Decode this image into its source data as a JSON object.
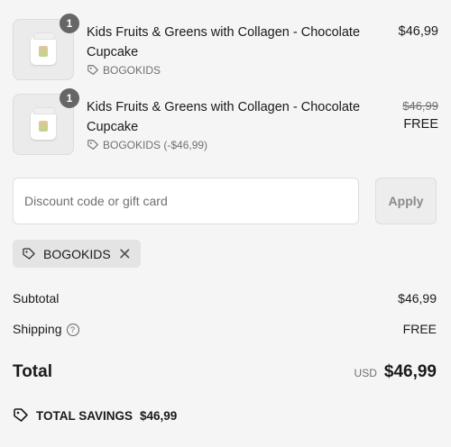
{
  "items": [
    {
      "quantity": "1",
      "title": "Kids Fruits & Greens with Collagen - Chocolate Cupcake",
      "discount_code": "BOGOKIDS",
      "price": "$46,99",
      "original_price": "",
      "final_price": ""
    },
    {
      "quantity": "1",
      "title": "Kids Fruits & Greens with Collagen - Chocolate Cupcake",
      "discount_code": "BOGOKIDS (-$46,99)",
      "price": "",
      "original_price": "$46,99",
      "final_price": "FREE"
    }
  ],
  "discount": {
    "placeholder": "Discount code or gift card",
    "apply_label": "Apply",
    "applied_code": "BOGOKIDS"
  },
  "summary": {
    "subtotal_label": "Subtotal",
    "subtotal_value": "$46,99",
    "shipping_label": "Shipping",
    "shipping_value": "FREE",
    "total_label": "Total",
    "currency": "USD",
    "total_value": "$46,99",
    "savings_label": "TOTAL SAVINGS",
    "savings_value": "$46,99"
  },
  "icons": {
    "tag": "tag-icon",
    "close": "close-icon",
    "help": "question-circle-icon",
    "savings": "price-tag-icon"
  }
}
